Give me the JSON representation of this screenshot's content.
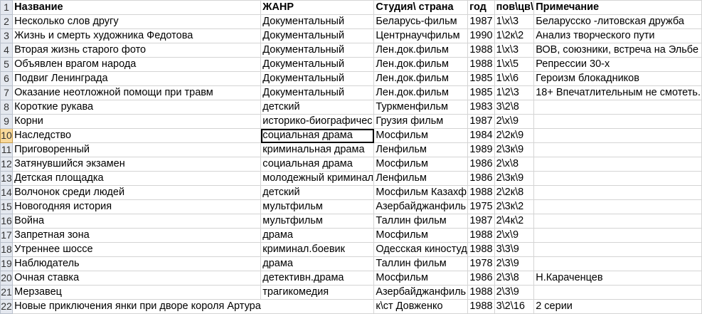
{
  "header": {
    "row_num": "1",
    "cols": [
      "Название",
      "ЖАНР",
      "Студия\\ страна",
      "год",
      "пов\\цв\\",
      "Примечание"
    ]
  },
  "active_row": "10",
  "rows": [
    {
      "n": "2",
      "title": "Несколько слов другу",
      "genre": "Документальный",
      "studio": "Беларусь-фильм",
      "year": "1987",
      "code": "1\\х\\3",
      "note": "Беларусско -литовская дружба"
    },
    {
      "n": "3",
      "title": "Жизнь и смерть художника Федотова",
      "genre": "Документальный",
      "studio": "Центрнаучфильм",
      "year": "1990",
      "code": "1\\2к\\2",
      "note": "Анализ творческого пути"
    },
    {
      "n": "4",
      "title": "Вторая жизнь старого фото",
      "genre": "Документальный",
      "studio": "Лен.док.фильм",
      "year": "1988",
      "code": "1\\х\\3",
      "note": "ВОВ, союзники, встреча на Эльбе"
    },
    {
      "n": "5",
      "title": "Объявлен врагом народа",
      "genre": "Документальный",
      "studio": "Лен.док.фильм",
      "year": "1988",
      "code": "1\\х\\5",
      "note": "Репрессии 30-х"
    },
    {
      "n": "6",
      "title": "Подвиг Ленинграда",
      "genre": "Документальный",
      "studio": "Лен.док.фильм",
      "year": "1985",
      "code": "1\\х\\6",
      "note": "Героизм блокадников"
    },
    {
      "n": "7",
      "title": "Оказание неотложной помощи при травм",
      "genre": "Документальный",
      "studio": "Лен.док.фильм",
      "year": "1985",
      "code": "1\\2\\3",
      "note": "18+ Впечатлительным не смотеть."
    },
    {
      "n": "8",
      "title": "Короткие рукава",
      "genre": "детский",
      "studio": "Туркменфильм",
      "year": "1983",
      "code": "3\\2\\8",
      "note": ""
    },
    {
      "n": "9",
      "title": "Корни",
      "genre": "историко-биографичес",
      "studio": "Грузия фильм",
      "year": "1987",
      "code": "2\\х\\9",
      "note": ""
    },
    {
      "n": "10",
      "title": "Наследство",
      "genre": "социальная драма",
      "studio": "Мосфильм",
      "year": "1984",
      "code": "2\\2к\\9",
      "note": ""
    },
    {
      "n": "11",
      "title": "Приговоренный",
      "genre": "криминальная драма",
      "studio": "Ленфильм",
      "year": "1989",
      "code": "2\\3к\\9",
      "note": ""
    },
    {
      "n": "12",
      "title": "Затянувшийся экзамен",
      "genre": "социальная драма",
      "studio": "Мосфильм",
      "year": "1986",
      "code": "2\\х\\8",
      "note": ""
    },
    {
      "n": "13",
      "title": "Детская площадка",
      "genre": "молодежный криминал",
      "studio": "Ленфильм",
      "year": "1986",
      "code": "2\\3к\\9",
      "note": ""
    },
    {
      "n": "14",
      "title": "Волчонок среди людей",
      "genre": "детский",
      "studio": "Мосфильм Казахф",
      "year": "1988",
      "code": "2\\2к\\8",
      "note": ""
    },
    {
      "n": "15",
      "title": "Новогодняя история",
      "genre": "мультфильм",
      "studio": "Азербайджанфиль",
      "year": "1975",
      "code": "2\\3к\\2",
      "note": ""
    },
    {
      "n": "16",
      "title": "Война",
      "genre": "мультфильм",
      "studio": "Таллин фильм",
      "year": "1987",
      "code": "2\\4к\\2",
      "note": ""
    },
    {
      "n": "17",
      "title": "Запретная зона",
      "genre": "драма",
      "studio": "Мосфильм",
      "year": "1988",
      "code": "2\\х\\9",
      "note": ""
    },
    {
      "n": "18",
      "title": "Утреннее шоссе",
      "genre": "криминал.боевик",
      "studio": "Одесская киностуд",
      "year": "1988",
      "code": "3\\3\\9",
      "note": ""
    },
    {
      "n": "19",
      "title": "Наблюдатель",
      "genre": "драма",
      "studio": "Таллин фильм",
      "year": "1978",
      "code": "2\\3\\9",
      "note": ""
    },
    {
      "n": "20",
      "title": "Очная ставка",
      "genre": "детективн.драма",
      "studio": "Мосфильм",
      "year": "1986",
      "code": "2\\3\\8",
      "note": "Н.Караченцев"
    },
    {
      "n": "21",
      "title": "Мерзавец",
      "genre": "трагикомедия",
      "studio": "Азербайджанфиль",
      "year": "1988",
      "code": "2\\3\\9",
      "note": ""
    },
    {
      "n": "22",
      "title": "Новые приключения янки при дворе короля Артура",
      "genre": "",
      "studio": "к\\ст Довженко",
      "year": "1988",
      "code": "3\\2\\16",
      "note": "2 серии"
    }
  ]
}
